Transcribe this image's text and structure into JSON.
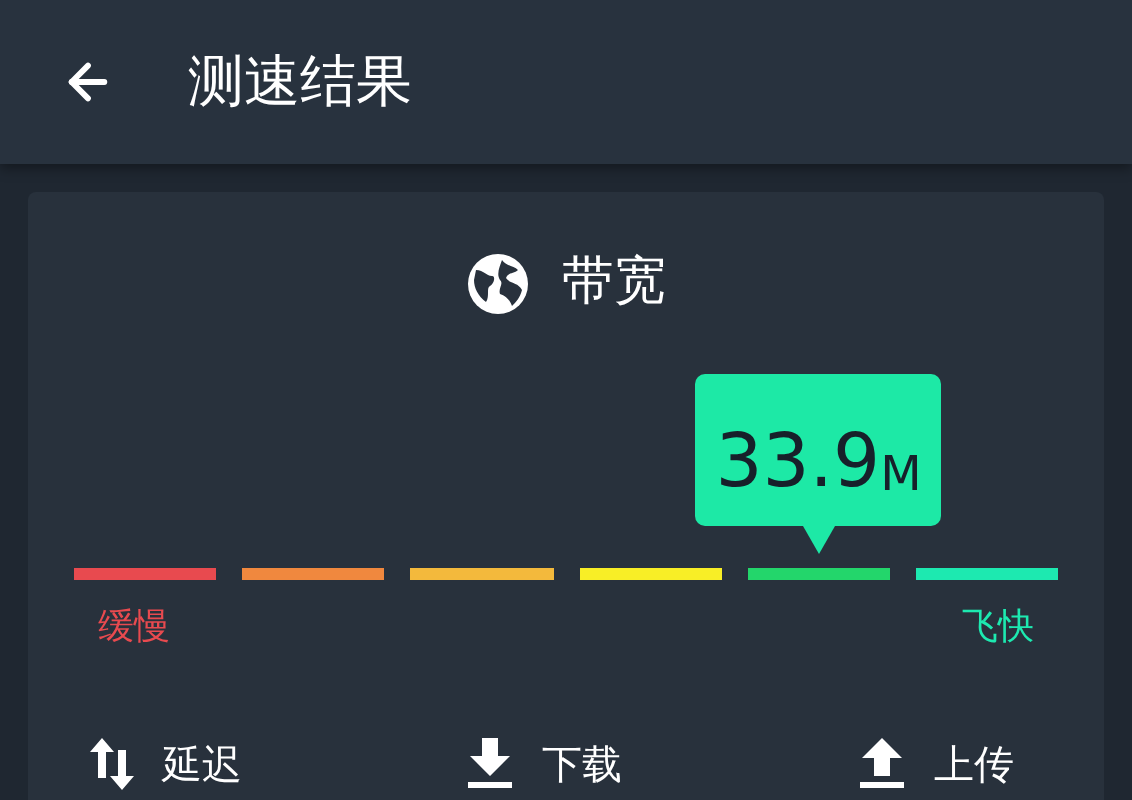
{
  "header": {
    "title": "测速结果"
  },
  "card": {
    "title": "带宽",
    "gauge": {
      "reading": "33.9",
      "unit": "M",
      "segments": [
        {
          "color": "#e84a4f",
          "selected": false
        },
        {
          "color": "#f0883e",
          "selected": false
        },
        {
          "color": "#f3b93c",
          "selected": false
        },
        {
          "color": "#f8ee26",
          "selected": false
        },
        {
          "color": "#23d66b",
          "selected": true
        },
        {
          "color": "#1de9b0",
          "selected": false
        }
      ],
      "low_label": "缓慢",
      "high_label": "飞快"
    },
    "metrics": [
      {
        "kind": "latency",
        "label": "延迟"
      },
      {
        "kind": "download",
        "label": "下载"
      },
      {
        "kind": "upload",
        "label": "上传"
      }
    ]
  }
}
